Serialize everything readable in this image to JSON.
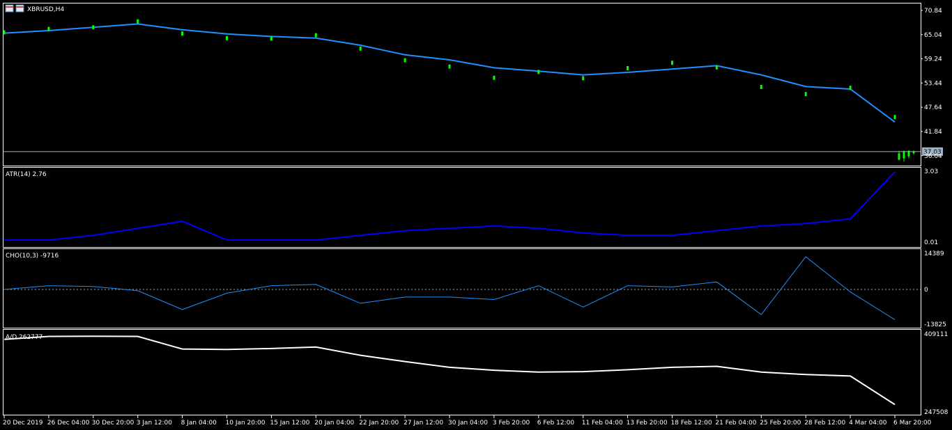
{
  "colors": {
    "background": "#000000",
    "frame": "#ffffff",
    "bull_candle": "#00ff00",
    "ma_line": "#1e90ff",
    "atr_line": "#0000ff",
    "cho_line": "#1e90ff",
    "ad_line": "#ffffff",
    "price_line": "#a0b4c8",
    "price_tag_bg": "#a0b4c8"
  },
  "chart_data": [
    {
      "panel": "price",
      "type": "candlestick",
      "title": "XBRUSD,H4",
      "yticks": [
        "70.84",
        "65.04",
        "59.24",
        "53.44",
        "47.64",
        "41.84",
        "36.04"
      ],
      "ylim": [
        34.0,
        72.0
      ],
      "current_price": "37.03",
      "x": [
        "20 Dec 2019",
        "26 Dec 04:00",
        "30 Dec 20:00",
        "3 Jan 12:00",
        "8 Jan 04:00",
        "10 Jan 20:00",
        "15 Jan 12:00",
        "20 Jan 04:00",
        "22 Jan 20:00",
        "27 Jan 12:00",
        "30 Jan 04:00",
        "3 Feb 20:00",
        "6 Feb 12:00",
        "11 Feb 04:00",
        "13 Feb 20:00",
        "18 Feb 12:00",
        "21 Feb 04:00",
        "25 Feb 20:00",
        "28 Feb 12:00",
        "4 Mar 04:00",
        "6 Mar 20:00"
      ],
      "close": [
        65.6,
        66.4,
        66.8,
        68.2,
        65.3,
        64.2,
        64.1,
        64.9,
        61.7,
        58.9,
        57.4,
        54.7,
        56.1,
        54.6,
        57.0,
        58.3,
        57.2,
        52.5,
        50.8,
        52.3,
        45.3
      ],
      "ma": [
        65.4,
        66.0,
        66.8,
        67.6,
        66.2,
        65.2,
        64.6,
        64.2,
        62.5,
        60.2,
        59.0,
        57.1,
        56.3,
        55.4,
        56.0,
        56.8,
        57.6,
        55.4,
        52.6,
        52.0,
        44.1
      ],
      "last_candles": [
        {
          "open": 36.6,
          "high": 37.2,
          "low": 34.9,
          "close": 35.1
        },
        {
          "open": 35.4,
          "high": 37.3,
          "low": 34.6,
          "close": 37.1
        },
        {
          "open": 37.2,
          "high": 37.4,
          "low": 35.4,
          "close": 35.9
        },
        {
          "open": 36.6,
          "high": 37.3,
          "low": 36.3,
          "close": 37.0
        }
      ]
    },
    {
      "panel": "atr",
      "type": "line",
      "title": "ATR(14) 2.76",
      "yticks": [
        "3.03",
        "0.01"
      ],
      "ylim": [
        0.01,
        3.03
      ],
      "values": [
        0.1,
        0.1,
        0.3,
        0.6,
        0.9,
        0.1,
        0.1,
        0.1,
        0.3,
        0.5,
        0.6,
        0.7,
        0.6,
        0.4,
        0.3,
        0.3,
        0.5,
        0.7,
        0.8,
        1.0,
        3.0
      ]
    },
    {
      "panel": "cho",
      "type": "line",
      "title": "CHO(10,3) -9716",
      "yticks": [
        "14389",
        "0",
        "-13825"
      ],
      "ylim": [
        -13825,
        14389
      ],
      "zero_line": true,
      "values": [
        0,
        1500,
        1200,
        -500,
        -8000,
        -1500,
        1500,
        2000,
        -5500,
        -3000,
        -3000,
        -4000,
        1500,
        -7000,
        1500,
        1000,
        3000,
        -10000,
        13000,
        -1000,
        -12000
      ]
    },
    {
      "panel": "ad",
      "type": "line",
      "title": "A/D 262777",
      "yticks": [
        "409111",
        "247508"
      ],
      "ylim": [
        247508,
        409111
      ],
      "values": [
        398000,
        404000,
        404500,
        404000,
        378000,
        377000,
        379000,
        382000,
        365000,
        352000,
        340000,
        334000,
        330000,
        331000,
        335000,
        340000,
        342000,
        330000,
        325000,
        322000,
        262777
      ]
    }
  ]
}
